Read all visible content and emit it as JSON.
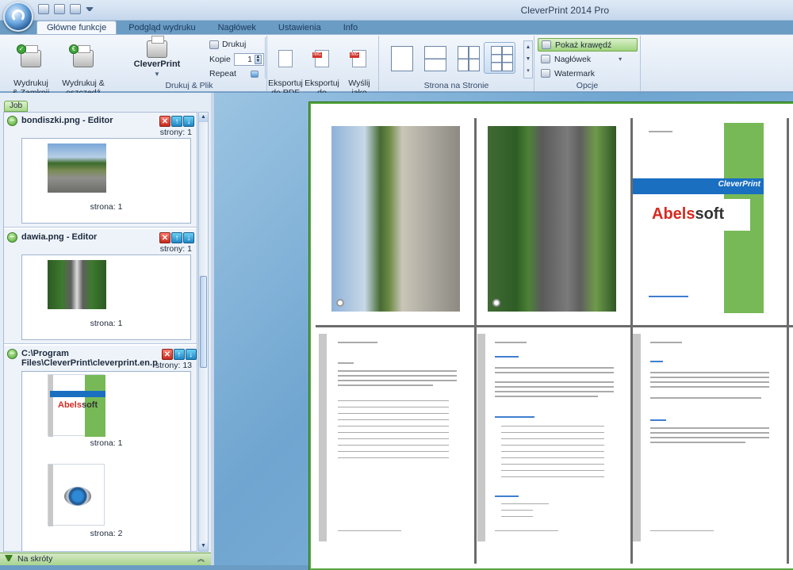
{
  "app": {
    "title": "CleverPrint 2014 Pro"
  },
  "tabs": [
    {
      "label": "Główne funkcje",
      "active": true
    },
    {
      "label": "Podgląd wydruku",
      "active": false
    },
    {
      "label": "Nagłówek",
      "active": false
    },
    {
      "label": "Ustawienia",
      "active": false
    },
    {
      "label": "Info",
      "active": false
    }
  ],
  "ribbon": {
    "print_group": {
      "label": "Drukuj & Plik",
      "print_close": "Wydrukuj\n& Zamknij",
      "print_save": "Wydrukuj &\noszczędź",
      "cleverprint": "CleverPrint",
      "drukuj": "Drukuj",
      "kopie_label": "Kopie",
      "kopie_value": "1",
      "repeat_label": "Repeat",
      "export_pdf": "Eksportuj\ndo PDF",
      "export_image": "Eksportuj\ndo obrazka",
      "send_image": "Wyślij\njako obraz"
    },
    "layout_group": {
      "label": "Strona na Stronie",
      "options": [
        "1 strona",
        "2 strony",
        "4 strony",
        "6 stron"
      ],
      "selected_index": 3
    },
    "options_group": {
      "label": "Opcje",
      "show_edges": "Pokaż krawędź",
      "show_edges_on": true,
      "header": "Nagłówek",
      "watermark": "Watermark"
    }
  },
  "job_panel": {
    "tab_label": "Job",
    "jobs": [
      {
        "name": "bondiszki.png - Editor",
        "pages_label": "strony: 1",
        "previews": [
          {
            "caption": "strona: 1"
          }
        ]
      },
      {
        "name": "dawia.png - Editor",
        "pages_label": "strony: 1",
        "previews": [
          {
            "caption": "strona: 1"
          }
        ]
      },
      {
        "name": "C:\\Program Files\\CleverPrint\\cleverprint.en.p",
        "pages_label": "strony: 13",
        "previews": [
          {
            "caption": "strona: 1"
          },
          {
            "caption": "strona: 2"
          }
        ]
      }
    ],
    "footer_label": "Na skróty"
  },
  "preview": {
    "brand": "CleverPrint",
    "logo_text_red": "Abels",
    "logo_text_dark": "soft"
  },
  "colors": {
    "accent_green": "#77b956",
    "ribbon_blue": "#dbe6f3",
    "brand_blue": "#1a6fc1",
    "brand_red": "#d62a21"
  }
}
